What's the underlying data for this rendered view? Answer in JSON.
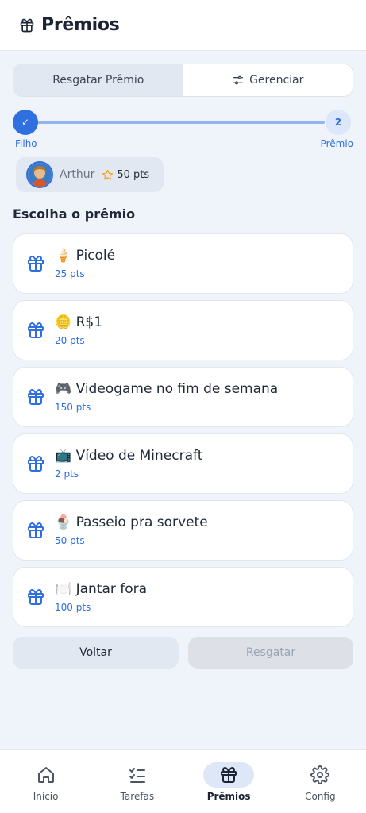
{
  "header": {
    "title": "Prêmios",
    "icon": "gift-icon"
  },
  "tabs": {
    "redeem_label": "Resgatar Prêmio",
    "manage_label": "Gerenciar",
    "active": "redeem"
  },
  "stepper": {
    "step1_mark": "✓",
    "step1_label": "Filho",
    "step2_number": "2",
    "step2_label": "Prêmio"
  },
  "child": {
    "name": "Arthur",
    "points": "50 pts"
  },
  "section_title": "Escolha o prêmio",
  "rewards": [
    {
      "title": "🍦 Picolé",
      "points": "25 pts"
    },
    {
      "title": "🪙 R$1",
      "points": "20 pts"
    },
    {
      "title": "🎮 Videogame no fim de semana",
      "points": "150 pts"
    },
    {
      "title": "📺 Vídeo de Minecraft",
      "points": "2 pts"
    },
    {
      "title": "🍨 Passeio pra sorvete",
      "points": "50 pts"
    },
    {
      "title": "🍽️ Jantar fora",
      "points": "100 pts"
    }
  ],
  "actions": {
    "back_label": "Voltar",
    "redeem_label": "Resgatar"
  },
  "nav": [
    {
      "label": "Início",
      "icon": "home-icon"
    },
    {
      "label": "Tarefas",
      "icon": "checklist-icon"
    },
    {
      "label": "Prêmios",
      "icon": "gift-icon"
    },
    {
      "label": "Config",
      "icon": "gear-icon"
    }
  ],
  "colors": {
    "accent": "#2f6fe0",
    "background": "#eff3fa",
    "muted": "#e2e8f1"
  }
}
